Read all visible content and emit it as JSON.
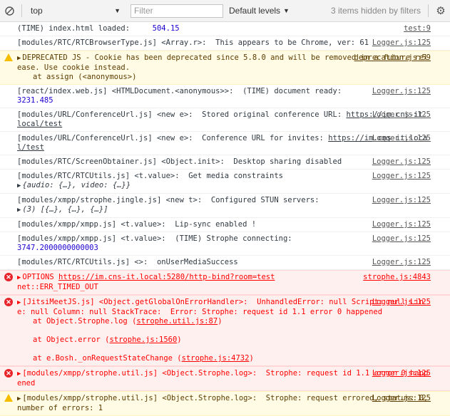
{
  "toolbar": {
    "context": "top",
    "filter_placeholder": "Filter",
    "levels_label": "Default levels",
    "hidden_text": "3 items hidden by filters"
  },
  "messages": [
    {
      "text": "(TIME) index.html loaded:",
      "num": "504.15",
      "src": "test:9"
    },
    {
      "text": "[modules/RTC/RTCBrowserType.js] <Array.r>:  This appears to be Chrome, ver: 61",
      "src": "Logger.js:125"
    },
    {
      "text": "DEPRECATED JS - Cookie has been deprecated since 5.8.0 and will be removed in a future release. Use cookie instead.",
      "extra": "at assign (<anonymous>)",
      "src": "deprecation.js:59"
    },
    {
      "text": "[react/index.web.js] <HTMLDocument.<anonymous>>:  (TIME) document ready:",
      "num": "3231.485",
      "src": "Logger.js:125"
    },
    {
      "text": "[modules/URL/ConferenceUrl.js] <new e>:  Stored original conference URL:",
      "link": "https://im.cns-it.local/test",
      "src": "Logger.js:125"
    },
    {
      "text": "[modules/URL/ConferenceUrl.js] <new e>:  Conference URL for invites:",
      "link": "https://im.cns-it.local/test",
      "src": "Logger.js:125"
    },
    {
      "text": "[modules/RTC/ScreenObtainer.js] <Object.init>:  Desktop sharing disabled",
      "src": "Logger.js:125"
    },
    {
      "text": "[modules/RTC/RTCUtils.js] <t.value>:  Get media constraints",
      "obj": "{audio: {…}, video: {…}}",
      "src": "Logger.js:125"
    },
    {
      "text": "[modules/xmpp/strophe.jingle.js] <new t>:  Configured STUN servers:",
      "obj": "(3) [{…}, {…}, {…}]",
      "src": "Logger.js:125"
    },
    {
      "text": "[modules/xmpp/xmpp.js] <t.value>:  Lip-sync enabled !",
      "src": "Logger.js:125"
    },
    {
      "text": "[modules/xmpp/xmpp.js] <t.value>:  (TIME) Strophe connecting:",
      "num": "3747.2000000000003",
      "src": "Logger.js:125"
    },
    {
      "text": "[modules/RTC/RTCUtils.js] <>:  onUserMediaSuccess",
      "src": "Logger.js:125"
    },
    {
      "text": "OPTIONS",
      "link": "https://im.cns-it.local:5280/http-bind?room=test",
      "tail": "net::ERR_TIMED_OUT",
      "src": "strophe.js:4843"
    },
    {
      "text": "[JitsiMeetJS.js] <Object.getGlobalOnErrorHandler>:  UnhandledError: null Script: null Line: null Column: null StackTrace:  Error: Strophe: request id 1.1 error 0 happened",
      "stack": [
        {
          "pre": "at Object.Strophe.log (",
          "loc": "strophe.util.js:87",
          "post": ")"
        },
        {
          "pre": "at Object.error (",
          "loc": "strophe.js:1560",
          "post": ")"
        },
        {
          "pre": "at e.Bosh._onRequestStateChange (",
          "loc": "strophe.js:4732",
          "post": ")"
        }
      ],
      "src": "Logger.js:125"
    },
    {
      "text": "[modules/xmpp/strophe.util.js] <Object.Strophe.log>:  Strophe: request id 1.1 error 0 happened",
      "src": "Logger.js:125"
    },
    {
      "text": "[modules/xmpp/strophe.util.js] <Object.Strophe.log>:  Strophe: request errored, status: 0, number of errors: 1",
      "src": "Logger.js:125"
    }
  ]
}
